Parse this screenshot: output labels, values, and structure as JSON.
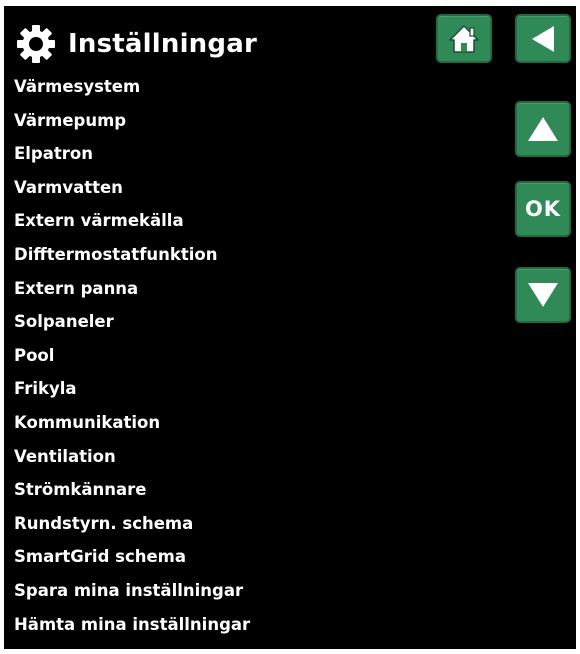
{
  "header": {
    "title": "Inställningar",
    "icon": "gear-icon"
  },
  "nav": {
    "home_icon": "home-icon",
    "back_icon": "back-arrow-icon",
    "up_icon": "arrow-up-icon",
    "ok_label": "OK",
    "down_icon": "arrow-down-icon"
  },
  "menu": {
    "items": [
      {
        "label": "Värmesystem"
      },
      {
        "label": "Värmepump"
      },
      {
        "label": "Elpatron"
      },
      {
        "label": "Varmvatten"
      },
      {
        "label": "Extern värmekälla"
      },
      {
        "label": "Difftermostatfunktion"
      },
      {
        "label": "Extern panna"
      },
      {
        "label": "Solpaneler"
      },
      {
        "label": "Pool"
      },
      {
        "label": "Frikyla"
      },
      {
        "label": "Kommunikation"
      },
      {
        "label": "Ventilation"
      },
      {
        "label": "Strömkännare"
      },
      {
        "label": "Rundstyrn. schema"
      },
      {
        "label": "SmartGrid schema"
      },
      {
        "label": "Spara mina inställningar"
      },
      {
        "label": "Hämta mina inställningar"
      }
    ]
  },
  "colors": {
    "background": "#000000",
    "text": "#ffffff",
    "button": "#2f8a57",
    "button_border": "#1f6a3f"
  }
}
